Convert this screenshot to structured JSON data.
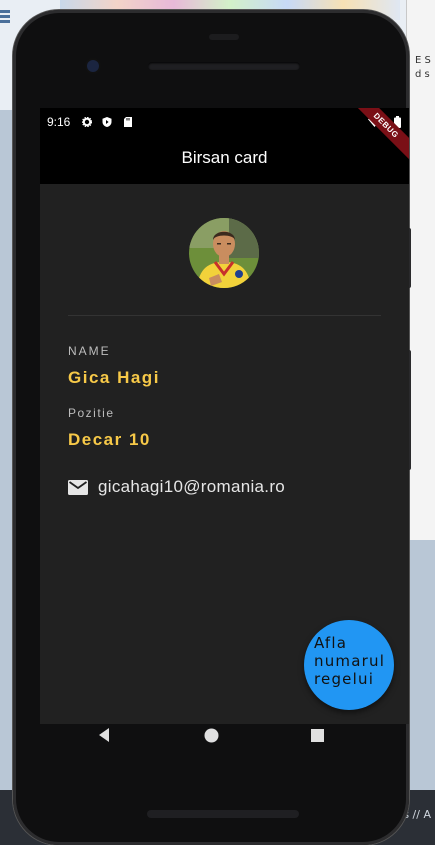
{
  "status_bar": {
    "time": "9:16"
  },
  "app_bar": {
    "title": "Birsan card",
    "debug_banner": "DEBUG"
  },
  "profile": {
    "name_label": "NAME",
    "name_value": "Gica Hagi",
    "position_label": "Pozitie",
    "position_value": "Decar 10",
    "email": "gicahagi10@romania.ro"
  },
  "fab": {
    "label": "Afla numarul regelui"
  },
  "colors": {
    "background": "#212121",
    "accent_yellow": "#f7c948",
    "fab_blue": "#2196f3",
    "debug_red": "#7a0f16"
  },
  "icons": [
    "settings-icon",
    "shield-icon",
    "sd-card-icon",
    "wifi-icon",
    "battery-icon",
    "email-icon",
    "back-icon",
    "home-icon",
    "recents-icon"
  ],
  "desktop": {
    "right_panel_text": "E S d s",
    "bottom_text": "Dar es // A"
  }
}
